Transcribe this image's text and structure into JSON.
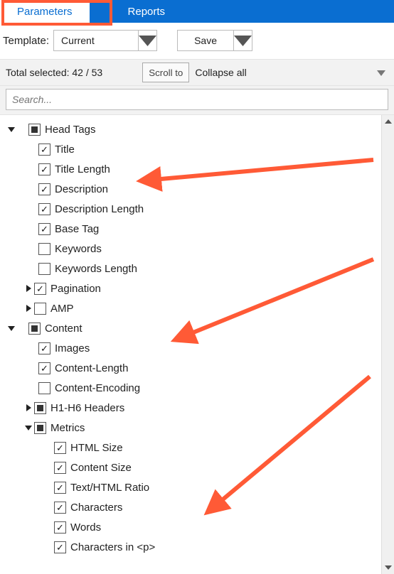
{
  "tabs": {
    "parameters": "Parameters",
    "reports": "Reports"
  },
  "toolbar": {
    "template_label": "Template:",
    "template_value": "Current",
    "save_label": "Save"
  },
  "stripbar": {
    "total_selected": "Total selected: 42 / 53",
    "scroll_to": "Scroll to",
    "collapse_all": "Collapse all"
  },
  "search": {
    "placeholder": "Search..."
  },
  "tree": {
    "head_tags": {
      "label": "Head Tags",
      "title": "Title",
      "title_length": "Title Length",
      "description": "Description",
      "description_length": "Description Length",
      "base_tag": "Base Tag",
      "keywords": "Keywords",
      "keywords_length": "Keywords Length",
      "pagination": "Pagination",
      "amp": "AMP"
    },
    "content": {
      "label": "Content",
      "images": "Images",
      "content_length": "Content-Length",
      "content_encoding": "Content-Encoding",
      "h1_h6": "H1-H6 Headers",
      "metrics": {
        "label": "Metrics",
        "html_size": "HTML Size",
        "content_size": "Content Size",
        "text_html_ratio": "Text/HTML Ratio",
        "characters": "Characters",
        "words": "Words",
        "characters_in_p": "Characters in <p>"
      }
    }
  },
  "annotations": {
    "color": "#ff5a36"
  }
}
